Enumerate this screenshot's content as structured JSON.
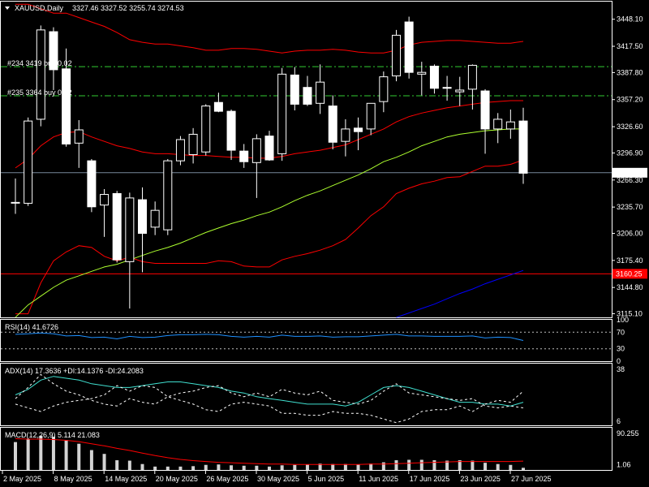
{
  "header": {
    "symbol": "XAUUSD,Daily",
    "ohlc": "3327.46 3327.52 3255.74 3274.53"
  },
  "orders": [
    {
      "label": "#234 3419 buy 0.02",
      "price": 3394.5
    },
    {
      "label": "#235 3364 buy 0.02",
      "price": 3361.5
    }
  ],
  "current_price": {
    "value": 3274.53,
    "label": "3274.53"
  },
  "hline": {
    "value": 3160.25,
    "label": "3160.25",
    "color": "#ff0000"
  },
  "colors": {
    "background": "#000000",
    "grid_border": "#ffffff",
    "bull_fill": "#000000",
    "bear_fill": "#ffffff",
    "wick": "#ffffff",
    "band": "#ff0000",
    "ma_slow": "#0000ff",
    "ma_fast": "#adff2f",
    "rsi_line": "#1e90ff",
    "adx_line": "#40e0d0",
    "macd_signal": "#ff0000"
  },
  "chart_data": [
    {
      "type": "candlestick",
      "title": "XAUUSD,Daily",
      "ylim": [
        3111,
        3468
      ],
      "y_ticks": [
        "3448.10",
        "3417.50",
        "3387.80",
        "3357.20",
        "3326.60",
        "3296.90",
        "3266.30",
        "3235.70",
        "3206.00",
        "3175.40",
        "3144.80",
        "3115.10"
      ],
      "x_ticks": [
        "2 May 2025",
        "8 May 2025",
        "14 May 2025",
        "20 May 2025",
        "26 May 2025",
        "30 May 2025",
        "5 Jun 2025",
        "11 Jun 2025",
        "17 Jun 2025",
        "23 Jun 2025",
        "27 Jun 2025"
      ],
      "candles": [
        {
          "o": 3241,
          "h": 3268,
          "l": 3228,
          "c": 3241
        },
        {
          "o": 3240,
          "h": 3337,
          "l": 3237,
          "c": 3333
        },
        {
          "o": 3335,
          "h": 3441,
          "l": 3327,
          "c": 3436
        },
        {
          "o": 3434,
          "h": 3439,
          "l": 3368,
          "c": 3391
        },
        {
          "o": 3392,
          "h": 3415,
          "l": 3304,
          "c": 3307
        },
        {
          "o": 3308,
          "h": 3334,
          "l": 3280,
          "c": 3323
        },
        {
          "o": 3288,
          "h": 3290,
          "l": 3230,
          "c": 3236
        },
        {
          "o": 3238,
          "h": 3256,
          "l": 3202,
          "c": 3250
        },
        {
          "o": 3251,
          "h": 3254,
          "l": 3173,
          "c": 3176
        },
        {
          "o": 3174,
          "h": 3252,
          "l": 3121,
          "c": 3246
        },
        {
          "o": 3244,
          "h": 3258,
          "l": 3162,
          "c": 3206
        },
        {
          "o": 3213,
          "h": 3242,
          "l": 3204,
          "c": 3232
        },
        {
          "o": 3210,
          "h": 3290,
          "l": 3204,
          "c": 3288
        },
        {
          "o": 3288,
          "h": 3316,
          "l": 3283,
          "c": 3312
        },
        {
          "o": 3295,
          "h": 3325,
          "l": 3285,
          "c": 3318
        },
        {
          "o": 3298,
          "h": 3352,
          "l": 3294,
          "c": 3350
        },
        {
          "o": 3354,
          "h": 3365,
          "l": 3343,
          "c": 3344
        },
        {
          "o": 3344,
          "h": 3346,
          "l": 3289,
          "c": 3300
        },
        {
          "o": 3299,
          "h": 3307,
          "l": 3280,
          "c": 3287
        },
        {
          "o": 3286,
          "h": 3318,
          "l": 3246,
          "c": 3313
        },
        {
          "o": 3316,
          "h": 3322,
          "l": 3288,
          "c": 3289
        },
        {
          "o": 3296,
          "h": 3393,
          "l": 3288,
          "c": 3386
        },
        {
          "o": 3385,
          "h": 3394,
          "l": 3345,
          "c": 3352
        },
        {
          "o": 3371,
          "h": 3384,
          "l": 3350,
          "c": 3352
        },
        {
          "o": 3353,
          "h": 3397,
          "l": 3341,
          "c": 3377
        },
        {
          "o": 3350,
          "h": 3362,
          "l": 3301,
          "c": 3309
        },
        {
          "o": 3310,
          "h": 3335,
          "l": 3293,
          "c": 3324
        },
        {
          "o": 3325,
          "h": 3337,
          "l": 3300,
          "c": 3321
        },
        {
          "o": 3324,
          "h": 3351,
          "l": 3317,
          "c": 3353
        },
        {
          "o": 3355,
          "h": 3389,
          "l": 3343,
          "c": 3383
        },
        {
          "o": 3384,
          "h": 3436,
          "l": 3378,
          "c": 3430
        },
        {
          "o": 3445,
          "h": 3451,
          "l": 3381,
          "c": 3388
        },
        {
          "o": 3386,
          "h": 3400,
          "l": 3362,
          "c": 3388
        },
        {
          "o": 3395,
          "h": 3397,
          "l": 3364,
          "c": 3370
        },
        {
          "o": 3371,
          "h": 3384,
          "l": 3356,
          "c": 3370
        },
        {
          "o": 3366,
          "h": 3383,
          "l": 3350,
          "c": 3368
        },
        {
          "o": 3369,
          "h": 3397,
          "l": 3346,
          "c": 3396
        },
        {
          "o": 3367,
          "h": 3369,
          "l": 3296,
          "c": 3324
        },
        {
          "o": 3324,
          "h": 3342,
          "l": 3308,
          "c": 3335
        },
        {
          "o": 3324,
          "h": 3346,
          "l": 3313,
          "c": 3332
        },
        {
          "o": 3333,
          "h": 3348,
          "l": 3262,
          "c": 3274
        }
      ],
      "series": [
        {
          "name": "Bollinger Upper",
          "values": [
            3465,
            3465,
            3460,
            3455,
            3455,
            3450,
            3445,
            3440,
            3433,
            3425,
            3422,
            3420,
            3420,
            3418,
            3416,
            3413,
            3413,
            3415,
            3415,
            3414,
            3412,
            3410,
            3412,
            3413,
            3413,
            3414,
            3413,
            3411,
            3410,
            3410,
            3413,
            3419,
            3422,
            3423,
            3424,
            3424,
            3423,
            3422,
            3421,
            3421,
            3423
          ]
        },
        {
          "name": "Bollinger Middle",
          "values": [
            3280,
            3290,
            3305,
            3315,
            3320,
            3321,
            3315,
            3310,
            3305,
            3302,
            3298,
            3296,
            3296,
            3295,
            3294,
            3294,
            3293,
            3292,
            3292,
            3291,
            3291,
            3293,
            3296,
            3298,
            3300,
            3303,
            3306,
            3312,
            3318,
            3324,
            3332,
            3338,
            3342,
            3345,
            3348,
            3350,
            3352,
            3354,
            3355,
            3356,
            3356
          ]
        },
        {
          "name": "Bollinger Lower",
          "values": [
            3115,
            3115,
            3150,
            3175,
            3185,
            3192,
            3190,
            3180,
            3175,
            3179,
            3174,
            3172,
            3172,
            3172,
            3172,
            3172,
            3175,
            3174,
            3169,
            3168,
            3168,
            3176,
            3180,
            3183,
            3187,
            3192,
            3199,
            3212,
            3226,
            3236,
            3251,
            3257,
            3262,
            3265,
            3269,
            3270,
            3276,
            3282,
            3282,
            3284,
            3289
          ]
        },
        {
          "name": "MA Fast",
          "values": [
            3111,
            3125,
            3135,
            3145,
            3153,
            3158,
            3163,
            3168,
            3171,
            3176,
            3181,
            3186,
            3190,
            3195,
            3201,
            3207,
            3212,
            3217,
            3221,
            3226,
            3230,
            3236,
            3243,
            3249,
            3254,
            3260,
            3266,
            3272,
            3279,
            3287,
            3292,
            3298,
            3305,
            3310,
            3315,
            3318,
            3320,
            3322,
            3323,
            3324,
            3324
          ]
        },
        {
          "name": "MA Slow",
          "values": [
            null,
            null,
            null,
            null,
            null,
            null,
            null,
            null,
            null,
            null,
            null,
            null,
            null,
            null,
            null,
            null,
            null,
            null,
            null,
            null,
            null,
            null,
            null,
            null,
            null,
            null,
            null,
            null,
            null,
            null,
            3111,
            3116,
            3121,
            3126,
            3132,
            3138,
            3143,
            3149,
            3154,
            3159,
            3164
          ]
        }
      ]
    },
    {
      "type": "line",
      "title": "RSI(14) 41.6726",
      "ylim": [
        0,
        100
      ],
      "y_ticks": [
        "100",
        "70",
        "30",
        "0"
      ],
      "levels": [
        70,
        30
      ],
      "series": [
        {
          "name": "RSI",
          "values": [
            65,
            66,
            68,
            66,
            61,
            62,
            57,
            58,
            54,
            60,
            57,
            58,
            62,
            64,
            64,
            65,
            64,
            60,
            58,
            60,
            58,
            63,
            60,
            60,
            61,
            58,
            59,
            59,
            61,
            63,
            65,
            61,
            61,
            60,
            60,
            60,
            61,
            56,
            58,
            57,
            50
          ]
        }
      ]
    },
    {
      "type": "line",
      "title": "ADX(14) 17.3636 +DI:14.1376 -DI:24.2083",
      "ylim": [
        6,
        38
      ],
      "y_ticks": [
        "38",
        "6"
      ],
      "series": [
        {
          "name": "ADX",
          "values": [
            22,
            25,
            30,
            32,
            31,
            30,
            28,
            27,
            26,
            26,
            27,
            28,
            29,
            29,
            28,
            27,
            26,
            24,
            23,
            21,
            20,
            19,
            18,
            17,
            17,
            17,
            16,
            18,
            22,
            26,
            27,
            26,
            24,
            22,
            20,
            18,
            18,
            17,
            17,
            16,
            18
          ]
        },
        {
          "name": "+DI",
          "values": [
            20,
            26,
            33,
            28,
            24,
            22,
            19,
            17,
            16,
            20,
            18,
            17,
            21,
            23,
            24,
            26,
            27,
            23,
            21,
            23,
            21,
            25,
            23,
            22,
            24,
            19,
            18,
            17,
            19,
            24,
            28,
            23,
            22,
            21,
            20,
            19,
            20,
            16,
            15,
            16,
            15
          ]
        },
        {
          "name": "-DI",
          "values": [
            17,
            15,
            13,
            16,
            18,
            19,
            20,
            22,
            27,
            24,
            27,
            26,
            21,
            19,
            17,
            14,
            13,
            17,
            18,
            17,
            16,
            12,
            12,
            11,
            11,
            13,
            12,
            12,
            11,
            9,
            7,
            9,
            13,
            14,
            14,
            16,
            13,
            17,
            19,
            18,
            24
          ]
        }
      ]
    },
    {
      "type": "bar",
      "title": "MACD(12,26,9) 5.114 21.083",
      "ylim": [
        0,
        90.255
      ],
      "y_ticks": [
        "90.255",
        "1.06"
      ],
      "series": [
        {
          "name": "MACD",
          "values": [
            66,
            74,
            81,
            79,
            71,
            62,
            47,
            38,
            23,
            22,
            14,
            8,
            8,
            8,
            9,
            12,
            13,
            11,
            10,
            10,
            8,
            11,
            12,
            13,
            15,
            14,
            14,
            13,
            15,
            18,
            23,
            24,
            24,
            23,
            22,
            23,
            22,
            17,
            14,
            12,
            5.1
          ]
        },
        {
          "name": "Signal",
          "values": [
            74,
            73,
            73,
            72,
            70,
            67,
            62,
            57,
            51,
            46,
            40,
            34,
            29,
            25,
            22,
            20,
            18,
            17,
            16,
            15,
            14,
            14,
            13,
            13,
            13,
            13,
            13,
            13,
            14,
            14,
            15,
            16,
            17,
            18,
            19,
            20,
            20,
            20,
            20,
            20,
            21
          ]
        }
      ]
    }
  ]
}
